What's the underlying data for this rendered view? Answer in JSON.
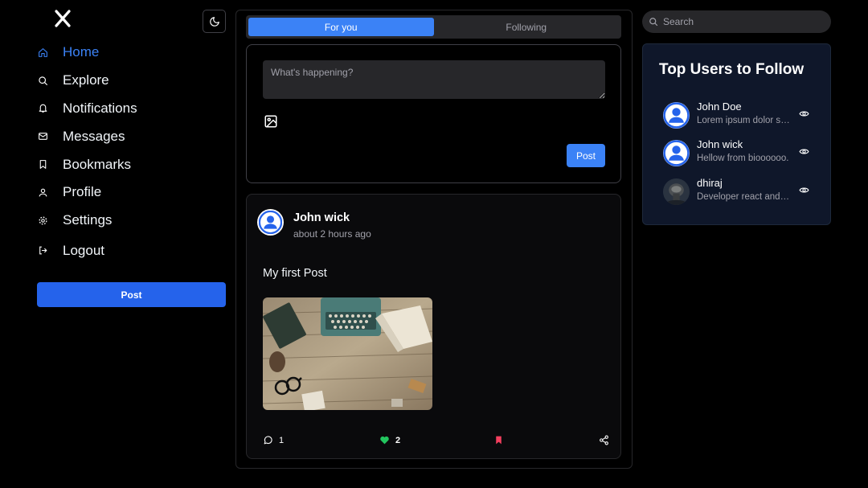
{
  "app": {
    "logo": "X"
  },
  "nav": {
    "items": [
      {
        "label": "Home",
        "icon": "home-icon",
        "active": true
      },
      {
        "label": "Explore",
        "icon": "search-icon"
      },
      {
        "label": "Notifications",
        "icon": "bell-icon"
      },
      {
        "label": "Messages",
        "icon": "mail-icon"
      },
      {
        "label": "Bookmarks",
        "icon": "bookmark-icon"
      },
      {
        "label": "Profile",
        "icon": "user-icon"
      },
      {
        "label": "Settings",
        "icon": "gear-icon"
      },
      {
        "label": "Logout",
        "icon": "logout-icon"
      }
    ],
    "post_button": "Post"
  },
  "feed": {
    "tabs": [
      {
        "label": "For you",
        "active": true
      },
      {
        "label": "Following"
      }
    ],
    "composer": {
      "placeholder": "What's happening?",
      "post_button": "Post"
    },
    "post": {
      "author": "John wick",
      "time": "about 2 hours ago",
      "text": "My first Post",
      "comments": "1",
      "likes": "2"
    }
  },
  "search": {
    "placeholder": "Search"
  },
  "follow": {
    "title": "Top Users to Follow",
    "users": [
      {
        "name": "John Doe",
        "bio": "Lorem ipsum dolor sit amet"
      },
      {
        "name": "John wick",
        "bio": "Hellow from bioooooo."
      },
      {
        "name": "dhiraj",
        "bio": "Developer react and node"
      }
    ]
  },
  "colors": {
    "accent": "#3b82f6",
    "like": "#22c55e",
    "bookmark": "#f43f5e",
    "card": "#0f172a"
  }
}
